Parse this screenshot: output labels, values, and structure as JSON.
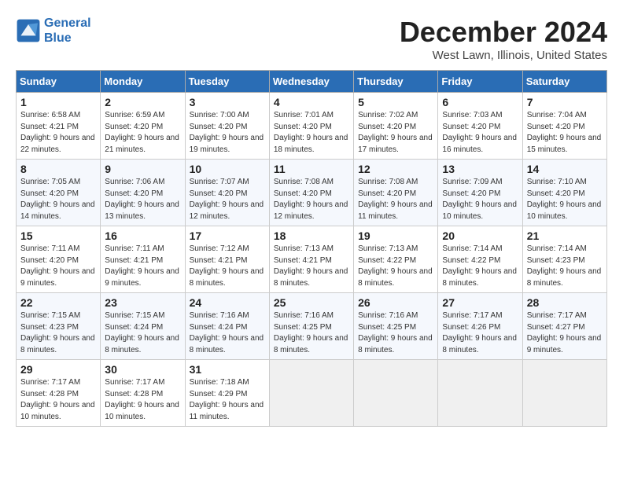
{
  "logo": {
    "line1": "General",
    "line2": "Blue"
  },
  "title": "December 2024",
  "location": "West Lawn, Illinois, United States",
  "days_header": [
    "Sunday",
    "Monday",
    "Tuesday",
    "Wednesday",
    "Thursday",
    "Friday",
    "Saturday"
  ],
  "weeks": [
    [
      {
        "day": "1",
        "sunrise": "6:58 AM",
        "sunset": "4:21 PM",
        "daylight": "9 hours and 22 minutes."
      },
      {
        "day": "2",
        "sunrise": "6:59 AM",
        "sunset": "4:20 PM",
        "daylight": "9 hours and 21 minutes."
      },
      {
        "day": "3",
        "sunrise": "7:00 AM",
        "sunset": "4:20 PM",
        "daylight": "9 hours and 19 minutes."
      },
      {
        "day": "4",
        "sunrise": "7:01 AM",
        "sunset": "4:20 PM",
        "daylight": "9 hours and 18 minutes."
      },
      {
        "day": "5",
        "sunrise": "7:02 AM",
        "sunset": "4:20 PM",
        "daylight": "9 hours and 17 minutes."
      },
      {
        "day": "6",
        "sunrise": "7:03 AM",
        "sunset": "4:20 PM",
        "daylight": "9 hours and 16 minutes."
      },
      {
        "day": "7",
        "sunrise": "7:04 AM",
        "sunset": "4:20 PM",
        "daylight": "9 hours and 15 minutes."
      }
    ],
    [
      {
        "day": "8",
        "sunrise": "7:05 AM",
        "sunset": "4:20 PM",
        "daylight": "9 hours and 14 minutes."
      },
      {
        "day": "9",
        "sunrise": "7:06 AM",
        "sunset": "4:20 PM",
        "daylight": "9 hours and 13 minutes."
      },
      {
        "day": "10",
        "sunrise": "7:07 AM",
        "sunset": "4:20 PM",
        "daylight": "9 hours and 12 minutes."
      },
      {
        "day": "11",
        "sunrise": "7:08 AM",
        "sunset": "4:20 PM",
        "daylight": "9 hours and 12 minutes."
      },
      {
        "day": "12",
        "sunrise": "7:08 AM",
        "sunset": "4:20 PM",
        "daylight": "9 hours and 11 minutes."
      },
      {
        "day": "13",
        "sunrise": "7:09 AM",
        "sunset": "4:20 PM",
        "daylight": "9 hours and 10 minutes."
      },
      {
        "day": "14",
        "sunrise": "7:10 AM",
        "sunset": "4:20 PM",
        "daylight": "9 hours and 10 minutes."
      }
    ],
    [
      {
        "day": "15",
        "sunrise": "7:11 AM",
        "sunset": "4:20 PM",
        "daylight": "9 hours and 9 minutes."
      },
      {
        "day": "16",
        "sunrise": "7:11 AM",
        "sunset": "4:21 PM",
        "daylight": "9 hours and 9 minutes."
      },
      {
        "day": "17",
        "sunrise": "7:12 AM",
        "sunset": "4:21 PM",
        "daylight": "9 hours and 8 minutes."
      },
      {
        "day": "18",
        "sunrise": "7:13 AM",
        "sunset": "4:21 PM",
        "daylight": "9 hours and 8 minutes."
      },
      {
        "day": "19",
        "sunrise": "7:13 AM",
        "sunset": "4:22 PM",
        "daylight": "9 hours and 8 minutes."
      },
      {
        "day": "20",
        "sunrise": "7:14 AM",
        "sunset": "4:22 PM",
        "daylight": "9 hours and 8 minutes."
      },
      {
        "day": "21",
        "sunrise": "7:14 AM",
        "sunset": "4:23 PM",
        "daylight": "9 hours and 8 minutes."
      }
    ],
    [
      {
        "day": "22",
        "sunrise": "7:15 AM",
        "sunset": "4:23 PM",
        "daylight": "9 hours and 8 minutes."
      },
      {
        "day": "23",
        "sunrise": "7:15 AM",
        "sunset": "4:24 PM",
        "daylight": "9 hours and 8 minutes."
      },
      {
        "day": "24",
        "sunrise": "7:16 AM",
        "sunset": "4:24 PM",
        "daylight": "9 hours and 8 minutes."
      },
      {
        "day": "25",
        "sunrise": "7:16 AM",
        "sunset": "4:25 PM",
        "daylight": "9 hours and 8 minutes."
      },
      {
        "day": "26",
        "sunrise": "7:16 AM",
        "sunset": "4:25 PM",
        "daylight": "9 hours and 8 minutes."
      },
      {
        "day": "27",
        "sunrise": "7:17 AM",
        "sunset": "4:26 PM",
        "daylight": "9 hours and 8 minutes."
      },
      {
        "day": "28",
        "sunrise": "7:17 AM",
        "sunset": "4:27 PM",
        "daylight": "9 hours and 9 minutes."
      }
    ],
    [
      {
        "day": "29",
        "sunrise": "7:17 AM",
        "sunset": "4:28 PM",
        "daylight": "9 hours and 10 minutes."
      },
      {
        "day": "30",
        "sunrise": "7:17 AM",
        "sunset": "4:28 PM",
        "daylight": "9 hours and 10 minutes."
      },
      {
        "day": "31",
        "sunrise": "7:18 AM",
        "sunset": "4:29 PM",
        "daylight": "9 hours and 11 minutes."
      },
      null,
      null,
      null,
      null
    ]
  ]
}
